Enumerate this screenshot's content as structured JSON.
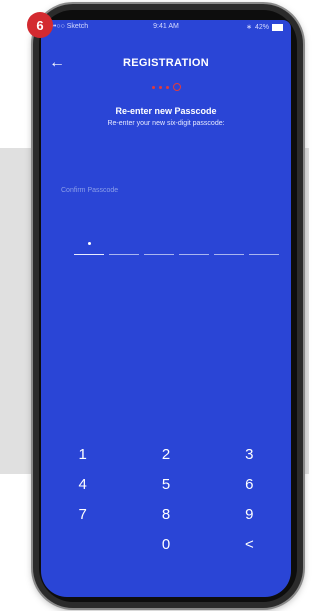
{
  "badge": {
    "step": "6"
  },
  "status_bar": {
    "carrier": "•••○○ Sketch",
    "time": "9:41 AM",
    "battery": "42%"
  },
  "nav": {
    "title": "REGISTRATION"
  },
  "content": {
    "heading": "Re-enter new Passcode",
    "subheading": "Re-enter your new six-digit passcode:",
    "field_label": "Confirm Passcode",
    "entered_digits": 1,
    "total_digits": 6
  },
  "keypad": {
    "k1": "1",
    "k2": "2",
    "k3": "3",
    "k4": "4",
    "k5": "5",
    "k6": "6",
    "k7": "7",
    "k8": "8",
    "k9": "9",
    "k0": "0",
    "backspace": "<"
  },
  "colors": {
    "screen": "#2a45d6",
    "accent": "#e23b3b",
    "badge": "#d32a30"
  }
}
